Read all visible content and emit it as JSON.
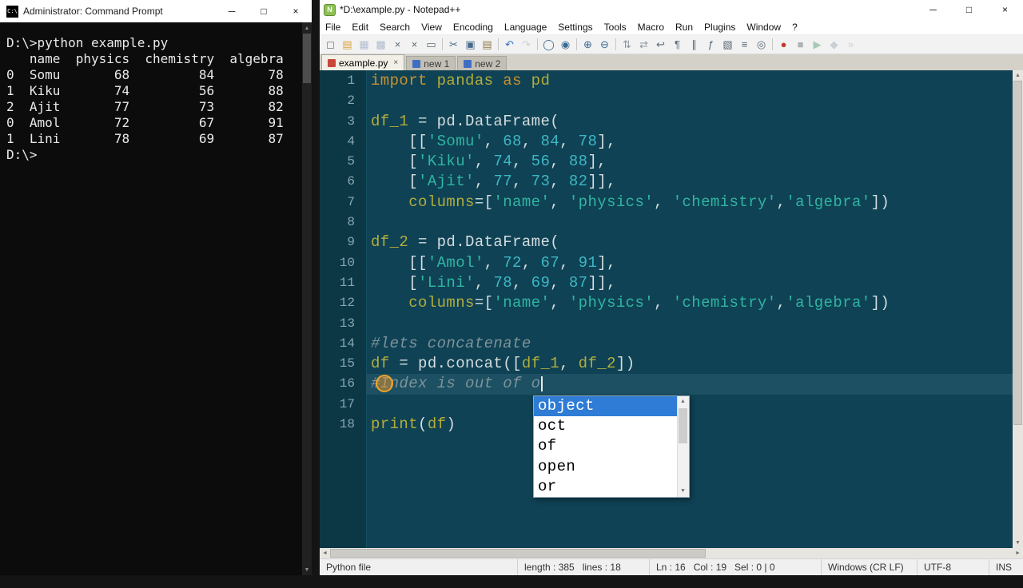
{
  "icons": {
    "minimize": "─",
    "maximize": "□",
    "close": "×",
    "close_small": "×",
    "scroll_up": "▲",
    "scroll_down": "▼",
    "scroll_left": "◄",
    "scroll_right": "►",
    "cmd_badge": "C:\\",
    "npp_badge": "N"
  },
  "window_controls": [
    {
      "name": "minimize-button",
      "icon": "minimize"
    },
    {
      "name": "maximize-button",
      "icon": "maximize"
    },
    {
      "name": "close-button",
      "icon": "close"
    }
  ],
  "cmd": {
    "title": "Administrator: Command Prompt",
    "lines": [
      "D:\\>python example.py",
      "   name  physics  chemistry  algebra",
      "0  Somu       68         84       78",
      "1  Kiku       74         56       88",
      "2  Ajit       77         73       82",
      "0  Amol       72         67       91",
      "1  Lini       78         69       87",
      "",
      "D:\\>"
    ]
  },
  "npp": {
    "title": "*D:\\example.py - Notepad++",
    "menu": [
      "File",
      "Edit",
      "Search",
      "View",
      "Encoding",
      "Language",
      "Settings",
      "Tools",
      "Macro",
      "Run",
      "Plugins",
      "Window",
      "?"
    ],
    "toolbar": [
      {
        "name": "new-file-icon",
        "glyph": "◻",
        "color": "#6b7d8a"
      },
      {
        "name": "open-folder-icon",
        "glyph": "▤",
        "color": "#d8a33c"
      },
      {
        "name": "save-icon",
        "glyph": "▦",
        "color": "#4a6a9a",
        "disabled": true
      },
      {
        "name": "save-all-icon",
        "glyph": "▩",
        "color": "#4a6a9a",
        "disabled": true
      },
      {
        "name": "close-icon",
        "glyph": "×",
        "color": "#5a6a76"
      },
      {
        "name": "close-all-icon",
        "glyph": "×",
        "color": "#5a6a76"
      },
      {
        "name": "print-icon",
        "glyph": "▭",
        "color": "#5a6a76"
      },
      {
        "sep": true
      },
      {
        "name": "cut-icon",
        "glyph": "✂",
        "color": "#4a6a8a"
      },
      {
        "name": "copy-icon",
        "glyph": "▣",
        "color": "#4a6a8a"
      },
      {
        "name": "paste-icon",
        "glyph": "▤",
        "color": "#8a7a4a"
      },
      {
        "sep": true
      },
      {
        "name": "undo-icon",
        "glyph": "↶",
        "color": "#2d6fc2"
      },
      {
        "name": "redo-icon",
        "glyph": "↷",
        "color": "#8a97a2",
        "disabled": true
      },
      {
        "sep": true
      },
      {
        "name": "find-icon",
        "glyph": "◯",
        "color": "#3a6a92"
      },
      {
        "name": "replace-icon",
        "glyph": "◉",
        "color": "#3a6a92"
      },
      {
        "sep": true
      },
      {
        "name": "zoom-in-icon",
        "glyph": "⊕",
        "color": "#3a6a92"
      },
      {
        "name": "zoom-out-icon",
        "glyph": "⊖",
        "color": "#3a6a92"
      },
      {
        "sep": true
      },
      {
        "name": "sync-vertical-icon",
        "glyph": "⇅",
        "color": "#8a97a2"
      },
      {
        "name": "sync-horizontal-icon",
        "glyph": "⇄",
        "color": "#8a97a2"
      },
      {
        "name": "word-wrap-icon",
        "glyph": "↩",
        "color": "#5a6a76"
      },
      {
        "name": "show-all-chars-icon",
        "glyph": "¶",
        "color": "#5a6a76"
      },
      {
        "name": "indent-guide-icon",
        "glyph": "∥",
        "color": "#5a6a76"
      },
      {
        "name": "function-list-icon",
        "glyph": "ƒ",
        "color": "#5a6a76"
      },
      {
        "name": "doc-map-icon",
        "glyph": "▧",
        "color": "#5a6a76"
      },
      {
        "name": "doc-list-icon",
        "glyph": "≡",
        "color": "#5a6a76"
      },
      {
        "name": "monitoring-icon",
        "glyph": "◎",
        "color": "#5a6a76"
      },
      {
        "sep": true
      },
      {
        "name": "record-macro-icon",
        "glyph": "●",
        "color": "#c23b2e"
      },
      {
        "name": "stop-record-icon",
        "glyph": "■",
        "color": "#444c55",
        "disabled": true
      },
      {
        "name": "play-macro-icon",
        "glyph": "▶",
        "color": "#2f8a4a",
        "disabled": true
      },
      {
        "name": "save-macro-icon",
        "glyph": "◆",
        "color": "#8a97a2",
        "disabled": true
      },
      {
        "name": "run-macro-multiple-icon",
        "glyph": "»",
        "color": "#8a97a2",
        "disabled": true
      }
    ],
    "tabs": [
      {
        "label": "example.py",
        "dirty": true,
        "active": true
      },
      {
        "label": "new 1",
        "dirty": false,
        "active": false
      },
      {
        "label": "new 2",
        "dirty": false,
        "active": false
      }
    ],
    "editor": {
      "lines": [
        {
          "n": 1,
          "t": [
            [
              "kw",
              "import"
            ],
            [
              "op",
              " "
            ],
            [
              "id",
              "pandas"
            ],
            [
              "op",
              " "
            ],
            [
              "kw",
              "as"
            ],
            [
              "op",
              " "
            ],
            [
              "id",
              "pd"
            ]
          ]
        },
        {
          "n": 2,
          "t": []
        },
        {
          "n": 3,
          "t": [
            [
              "id",
              "df_1"
            ],
            [
              "op",
              " = "
            ],
            [
              "pl",
              "pd.DataFrame("
            ]
          ]
        },
        {
          "n": 4,
          "t": [
            [
              "op",
              "    [["
            ],
            [
              "str",
              "'Somu'"
            ],
            [
              "op",
              ", "
            ],
            [
              "num",
              "68"
            ],
            [
              "op",
              ", "
            ],
            [
              "num",
              "84"
            ],
            [
              "op",
              ", "
            ],
            [
              "num",
              "78"
            ],
            [
              "op",
              "],"
            ]
          ]
        },
        {
          "n": 5,
          "t": [
            [
              "op",
              "    ["
            ],
            [
              "str",
              "'Kiku'"
            ],
            [
              "op",
              ", "
            ],
            [
              "num",
              "74"
            ],
            [
              "op",
              ", "
            ],
            [
              "num",
              "56"
            ],
            [
              "op",
              ", "
            ],
            [
              "num",
              "88"
            ],
            [
              "op",
              "],"
            ]
          ]
        },
        {
          "n": 6,
          "t": [
            [
              "op",
              "    ["
            ],
            [
              "str",
              "'Ajit'"
            ],
            [
              "op",
              ", "
            ],
            [
              "num",
              "77"
            ],
            [
              "op",
              ", "
            ],
            [
              "num",
              "73"
            ],
            [
              "op",
              ", "
            ],
            [
              "num",
              "82"
            ],
            [
              "op",
              "]],"
            ]
          ]
        },
        {
          "n": 7,
          "t": [
            [
              "op",
              "    "
            ],
            [
              "id",
              "columns"
            ],
            [
              "op",
              "=["
            ],
            [
              "str",
              "'name'"
            ],
            [
              "op",
              ", "
            ],
            [
              "str",
              "'physics'"
            ],
            [
              "op",
              ", "
            ],
            [
              "str",
              "'chemistry'"
            ],
            [
              "op",
              ","
            ],
            [
              "str",
              "'algebra'"
            ],
            [
              "op",
              "])"
            ]
          ]
        },
        {
          "n": 8,
          "t": []
        },
        {
          "n": 9,
          "t": [
            [
              "id",
              "df_2"
            ],
            [
              "op",
              " = "
            ],
            [
              "pl",
              "pd.DataFrame("
            ]
          ]
        },
        {
          "n": 10,
          "t": [
            [
              "op",
              "    [["
            ],
            [
              "str",
              "'Amol'"
            ],
            [
              "op",
              ", "
            ],
            [
              "num",
              "72"
            ],
            [
              "op",
              ", "
            ],
            [
              "num",
              "67"
            ],
            [
              "op",
              ", "
            ],
            [
              "num",
              "91"
            ],
            [
              "op",
              "],"
            ]
          ]
        },
        {
          "n": 11,
          "t": [
            [
              "op",
              "    ["
            ],
            [
              "str",
              "'Lini'"
            ],
            [
              "op",
              ", "
            ],
            [
              "num",
              "78"
            ],
            [
              "op",
              ", "
            ],
            [
              "num",
              "69"
            ],
            [
              "op",
              ", "
            ],
            [
              "num",
              "87"
            ],
            [
              "op",
              "]],"
            ]
          ]
        },
        {
          "n": 12,
          "t": [
            [
              "op",
              "    "
            ],
            [
              "id",
              "columns"
            ],
            [
              "op",
              "=["
            ],
            [
              "str",
              "'name'"
            ],
            [
              "op",
              ", "
            ],
            [
              "str",
              "'physics'"
            ],
            [
              "op",
              ", "
            ],
            [
              "str",
              "'chemistry'"
            ],
            [
              "op",
              ","
            ],
            [
              "str",
              "'algebra'"
            ],
            [
              "op",
              "])"
            ]
          ]
        },
        {
          "n": 13,
          "t": []
        },
        {
          "n": 14,
          "t": [
            [
              "com",
              "#lets concatenate"
            ]
          ]
        },
        {
          "n": 15,
          "t": [
            [
              "id",
              "df"
            ],
            [
              "op",
              " = "
            ],
            [
              "pl",
              "pd.concat(["
            ],
            [
              "id",
              "df_1"
            ],
            [
              "op",
              ", "
            ],
            [
              "id",
              "df_2"
            ],
            [
              "op",
              "])"
            ]
          ]
        },
        {
          "n": 16,
          "cur": true,
          "caret": true,
          "t": [
            [
              "com",
              "#Index is out of o"
            ]
          ]
        },
        {
          "n": 17,
          "t": []
        },
        {
          "n": 18,
          "t": [
            [
              "id",
              "print"
            ],
            [
              "op",
              "("
            ],
            [
              "id",
              "df"
            ],
            [
              "op",
              ")"
            ]
          ]
        }
      ]
    },
    "autocomplete": {
      "items": [
        "object",
        "oct",
        "of",
        "open",
        "or"
      ],
      "selected": 0
    },
    "status": {
      "doc_type": "Python file",
      "length_lines": "length : 385   lines : 18",
      "position": "Ln : 16   Col : 19   Sel : 0 | 0",
      "eol": "Windows (CR LF)",
      "encoding": "UTF-8",
      "mode": "INS"
    }
  }
}
